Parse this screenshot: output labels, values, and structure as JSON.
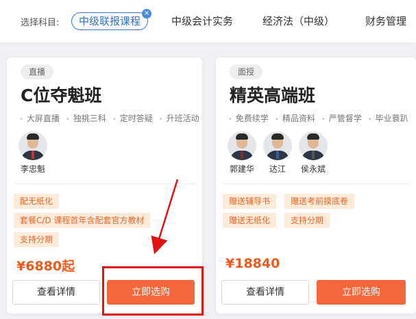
{
  "filter": {
    "label": "选择科目:",
    "tabs": [
      {
        "label": "中级联报课程",
        "active": true
      },
      {
        "label": "中级会计实务"
      },
      {
        "label": "经济法（中级）"
      },
      {
        "label": "财务管理"
      }
    ],
    "close_glyph": "×"
  },
  "cards": [
    {
      "badge": "直播",
      "title": "C位夺魁班",
      "features": [
        "大屏直播",
        "独挑三科",
        "定时答疑",
        "升班活动"
      ],
      "teachers": [
        {
          "name": "李忠魁"
        }
      ],
      "tags": [
        "配无纸化",
        "套餐C/D 课程首年含配套官方教材",
        "支持分期"
      ],
      "price": "¥6880起",
      "detail_label": "查看详情",
      "buy_label": "立即选购"
    },
    {
      "badge": "面授",
      "title": "精英高端班",
      "features": [
        "免费续学",
        "精品资料",
        "严管督学",
        "毕业蓑趴"
      ],
      "teachers": [
        {
          "name": "郭建华"
        },
        {
          "name": "达江"
        },
        {
          "name": "侯永斌"
        }
      ],
      "tags": [
        "赠送辅导书",
        "赠送考前摸底卷",
        "赠送无纸化",
        "支持分期"
      ],
      "price": "¥18840",
      "detail_label": "查看详情",
      "buy_label": "立即选购"
    }
  ],
  "colors": {
    "accent_blue": "#3a7bd5",
    "price_orange": "#f25a1b",
    "button_orange": "#f5673a",
    "tag_bg": "#fdebd9",
    "annotation_red": "#e11212"
  }
}
